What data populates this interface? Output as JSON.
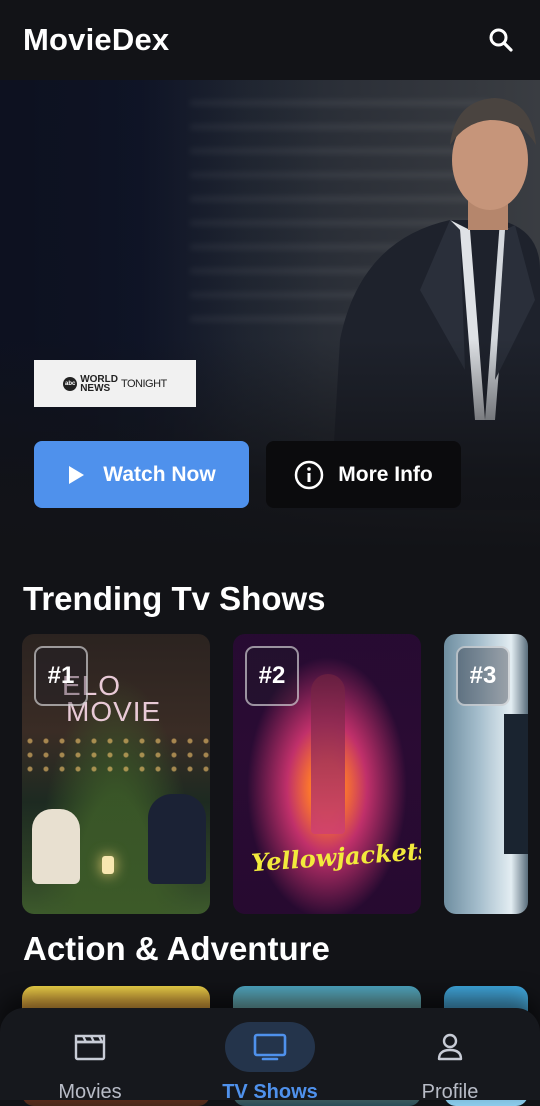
{
  "header": {
    "title": "MovieDex",
    "search_icon": "search-icon"
  },
  "hero": {
    "logo": {
      "badge": "abc",
      "line1": "WORLD",
      "line2": "NEWS",
      "line3": "TONIGHT"
    },
    "watch_label": "Watch Now",
    "more_label": "More Info"
  },
  "sections": {
    "trending_title": "Trending Tv Shows",
    "action_title": "Action & Adventure"
  },
  "trending": [
    {
      "rank": "#1",
      "poster_title_1": "ELO",
      "poster_title_2": "MOVIE"
    },
    {
      "rank": "#2",
      "poster_title": "Yellowjackets"
    },
    {
      "rank": "#3"
    }
  ],
  "nav": {
    "movies": "Movies",
    "tvshows": "TV Shows",
    "profile": "Profile",
    "active": "tvshows"
  },
  "colors": {
    "accent": "#4f91ec",
    "background": "#121317",
    "nav_bg": "#16181d"
  }
}
